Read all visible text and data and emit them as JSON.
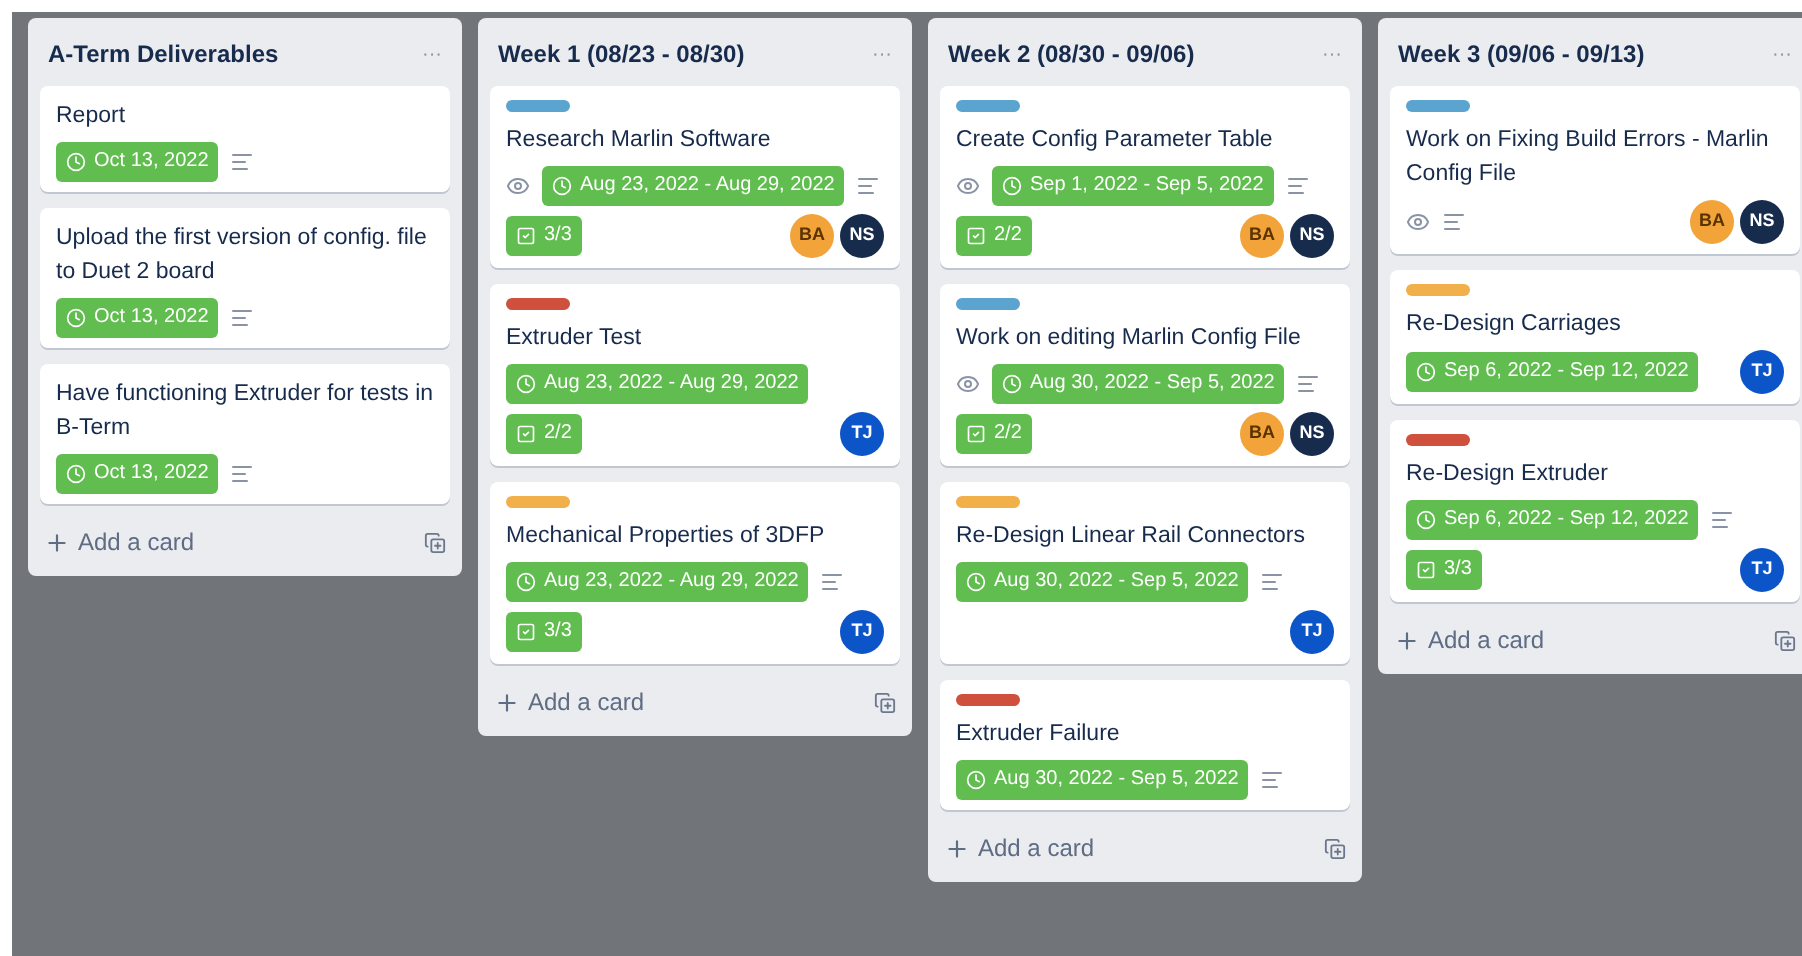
{
  "lists": [
    {
      "title": "A-Term Deliverables",
      "menu": "···",
      "add_card": "Add a card",
      "cards": [
        {
          "title": "Report",
          "watching": false,
          "due": "Oct 13, 2022",
          "description": true
        },
        {
          "title": "Upload the first version of config. file to Duet 2 board",
          "watching": false,
          "due": "Oct 13, 2022",
          "description": true
        },
        {
          "title": "Have functioning Extruder for tests in B-Term",
          "watching": false,
          "due": "Oct 13, 2022",
          "description": true
        }
      ]
    },
    {
      "title": "Week 1 (08/23 - 08/30)",
      "menu": "···",
      "add_card": "Add a card",
      "cards": [
        {
          "color": "#5ba4cf",
          "title": "Research Marlin Software",
          "watching": true,
          "due": "Aug 23, 2022 - Aug 29, 2022",
          "description": true,
          "checklist": "3/3",
          "members": [
            {
              "initials": "BA",
              "color": "#f2a33a"
            },
            {
              "initials": "NS",
              "color": "#172b4d"
            }
          ]
        },
        {
          "color": "#cf513d",
          "title": "Extruder Test",
          "watching": false,
          "due": "Aug 23, 2022 - Aug 29, 2022",
          "description": false,
          "checklist": "2/2",
          "members": [
            {
              "initials": "TJ",
              "color": "#0c55c8"
            }
          ]
        },
        {
          "color": "#f2b04b",
          "title": "Mechanical Properties of 3DFP",
          "watching": false,
          "due": "Aug 23, 2022 - Aug 29, 2022",
          "description": true,
          "checklist": "3/3",
          "members": [
            {
              "initials": "TJ",
              "color": "#0c55c8"
            }
          ]
        }
      ]
    },
    {
      "title": "Week 2 (08/30 - 09/06)",
      "menu": "···",
      "add_card": "Add a card",
      "cards": [
        {
          "color": "#5ba4cf",
          "title": "Create Config Parameter Table",
          "watching": true,
          "due": "Sep 1, 2022 - Sep 5, 2022",
          "description": true,
          "checklist": "2/2",
          "members": [
            {
              "initials": "BA",
              "color": "#f2a33a"
            },
            {
              "initials": "NS",
              "color": "#172b4d"
            }
          ]
        },
        {
          "color": "#5ba4cf",
          "title": "Work on editing Marlin Config File",
          "watching": true,
          "due": "Aug 30, 2022 - Sep 5, 2022",
          "description": true,
          "checklist": "2/2",
          "members": [
            {
              "initials": "BA",
              "color": "#f2a33a"
            },
            {
              "initials": "NS",
              "color": "#172b4d"
            }
          ]
        },
        {
          "color": "#f2b04b",
          "title": "Re-Design Linear Rail Connectors",
          "watching": false,
          "due": "Aug 30, 2022 - Sep 5, 2022",
          "description": true,
          "members": [
            {
              "initials": "TJ",
              "color": "#0c55c8"
            }
          ]
        },
        {
          "color": "#cf513d",
          "title": "Extruder Failure",
          "watching": false,
          "due": "Aug 30, 2022 - Sep 5, 2022",
          "description": true
        }
      ]
    },
    {
      "title": "Week 3 (09/06 - 09/13)",
      "menu": "···",
      "add_card": "Add a card",
      "cards": [
        {
          "color": "#5ba4cf",
          "title": "Work on Fixing Build Errors - Marlin Config File",
          "watching": true,
          "description": true,
          "members": [
            {
              "initials": "BA",
              "color": "#f2a33a"
            },
            {
              "initials": "NS",
              "color": "#172b4d"
            }
          ]
        },
        {
          "color": "#f2b04b",
          "title": "Re-Design Carriages",
          "watching": false,
          "due": "Sep 6, 2022 - Sep 12, 2022",
          "description": false,
          "members": [
            {
              "initials": "TJ",
              "color": "#0c55c8"
            }
          ]
        },
        {
          "color": "#cf513d",
          "title": "Re-Design Extruder",
          "watching": false,
          "due": "Sep 6, 2022 - Sep 12, 2022",
          "description": true,
          "checklist": "3/3",
          "members": [
            {
              "initials": "TJ",
              "color": "#0c55c8"
            }
          ]
        }
      ]
    }
  ]
}
